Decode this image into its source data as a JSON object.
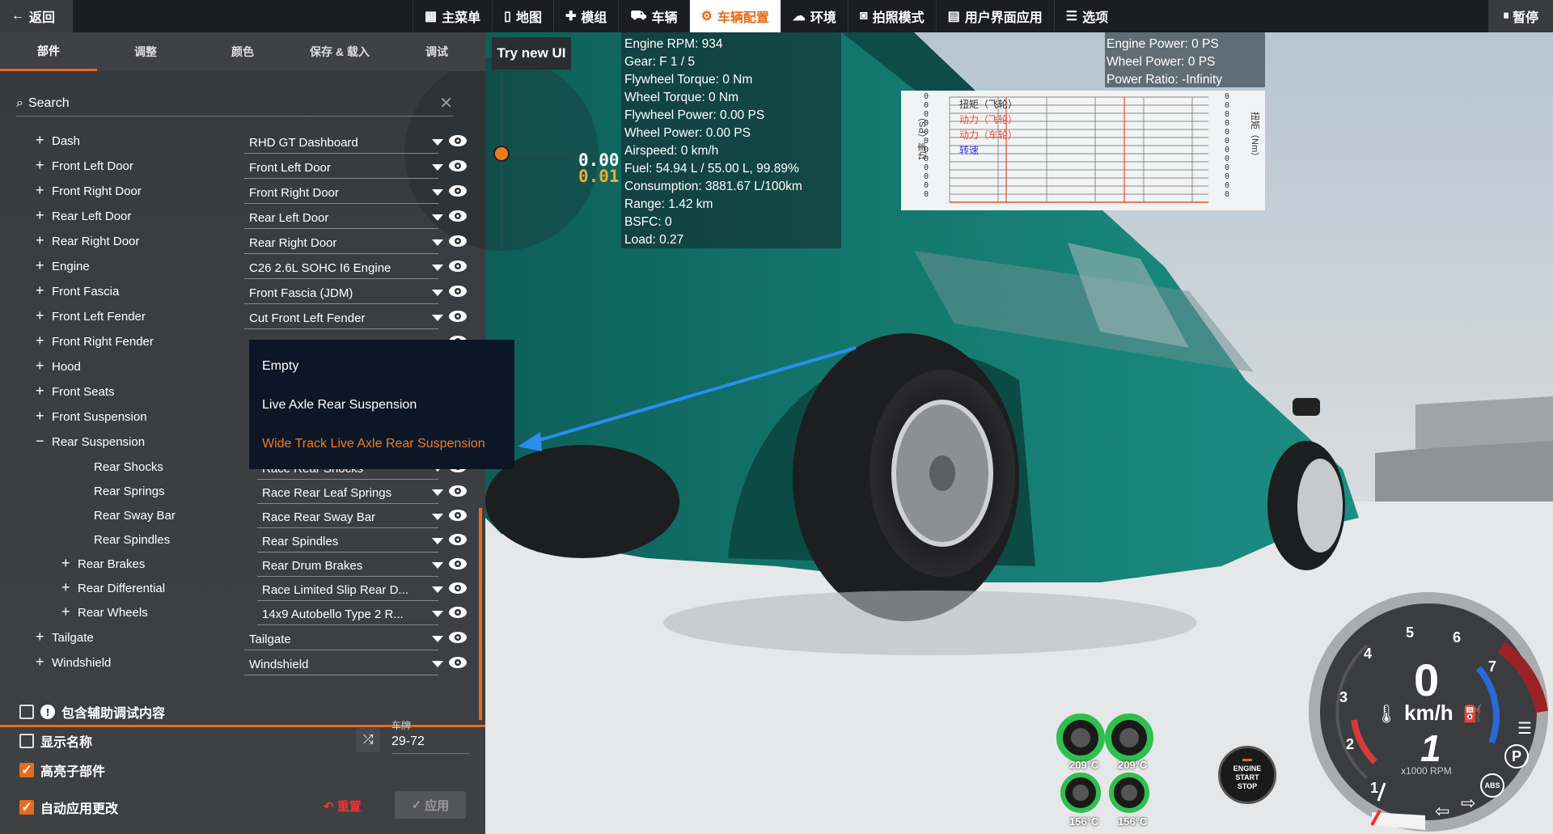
{
  "topbar": {
    "back_label": "返回",
    "menu": [
      "主菜单",
      "地图",
      "模组",
      "车辆",
      "车辆配置",
      "环境",
      "拍照模式",
      "用户界面应用",
      "选项"
    ],
    "active_index": 4,
    "pause_label": "暂停"
  },
  "panel": {
    "tabs": [
      "部件",
      "调整",
      "颜色",
      "保存 & 载入",
      "调试"
    ],
    "active_tab": 0,
    "search_label": "Search",
    "search_clear": "✕",
    "rows": [
      {
        "label": "Dash",
        "value": "RHD GT Dashboard",
        "prefix": "+"
      },
      {
        "label": "Front Left Door",
        "value": "Front Left Door",
        "prefix": "+"
      },
      {
        "label": "Front Right Door",
        "value": "Front Right Door",
        "prefix": "+"
      },
      {
        "label": "Rear Left Door",
        "value": "Rear Left Door",
        "prefix": "+"
      },
      {
        "label": "Rear Right Door",
        "value": "Rear Right Door",
        "prefix": "+"
      },
      {
        "label": "Engine",
        "value": "C26 2.6L SOHC I6 Engine",
        "prefix": "+"
      },
      {
        "label": "Front Fascia",
        "value": "Front Fascia (JDM)",
        "prefix": "+"
      },
      {
        "label": "Front Left Fender",
        "value": "Cut Front Left Fender",
        "prefix": "+"
      },
      {
        "label": "Front Right Fender",
        "value": "",
        "prefix": "+"
      },
      {
        "label": "Hood",
        "value": "",
        "prefix": "+"
      },
      {
        "label": "Front Seats",
        "value": "",
        "prefix": "+"
      },
      {
        "label": "Front Suspension",
        "value": "",
        "prefix": "+"
      },
      {
        "label": "Rear Suspension",
        "value": "",
        "prefix": "−"
      },
      {
        "label": "Rear Shocks",
        "value": "Race Rear Shocks",
        "prefix": ""
      },
      {
        "label": "Rear Springs",
        "value": "Race Rear Leaf Springs",
        "prefix": ""
      },
      {
        "label": "Rear Sway Bar",
        "value": "Race Rear Sway Bar",
        "prefix": ""
      },
      {
        "label": "Rear Spindles",
        "value": "Rear Spindles",
        "prefix": ""
      },
      {
        "label": "Rear Brakes",
        "value": "Rear Drum Brakes",
        "prefix": "+"
      },
      {
        "label": "Rear Differential",
        "value": "Race Limited Slip Rear D...",
        "prefix": "+"
      },
      {
        "label": "Rear Wheels",
        "value": "14x9 Autobello Type 2 R...",
        "prefix": "+"
      },
      {
        "label": "Tailgate",
        "value": "Tailgate",
        "prefix": "+"
      },
      {
        "label": "Windshield",
        "value": "Windshield",
        "prefix": "+"
      }
    ],
    "dropdown": [
      "Empty",
      "Live Axle Rear Suspension",
      "Wide Track Live Axle Rear Suspension"
    ],
    "dropdown_selected": 2,
    "options": [
      {
        "label": "包含辅助调试内容",
        "checked": false
      },
      {
        "label": "显示名称",
        "checked": false
      },
      {
        "label": "高亮子部件",
        "checked": true
      },
      {
        "label": "自动应用更改",
        "checked": true
      }
    ],
    "plate_label": "车牌",
    "plate_value": "29-72",
    "reset_label": "重置",
    "apply_label": "应用"
  },
  "try_new_ui": "Try new UI",
  "overlay_numbers": {
    "a": "0.00",
    "b": "0.01"
  },
  "engine_info": [
    "Engine RPM: 934",
    "Gear: F 1 / 5",
    "Flywheel Torque: 0 Nm",
    "Wheel Torque: 0 Nm",
    "Flywheel Power: 0.00 PS",
    "Wheel Power: 0.00 PS",
    "Airspeed: 0 km/h",
    "Fuel: 54.94 L / 55.00 L, 99.89%",
    "Consumption: 3881.67 L/100km",
    "Range: 1.42 km",
    "BSFC: 0",
    "Load: 0.27"
  ],
  "power_info": [
    "Engine Power: 0 PS",
    "Wheel Power: 0 PS",
    "Power Ratio: -Infinity"
  ],
  "chart": {
    "legend": [
      {
        "label": "扭矩（飞轮）",
        "color": "#333333"
      },
      {
        "label": "动力（飞轮）",
        "color": "#e84b3a"
      },
      {
        "label": "动力（车轮）",
        "color": "#e84b3a"
      },
      {
        "label": "转速",
        "color": "#3b3bd6"
      }
    ],
    "left_axis_label": "功率（PS）",
    "right_axis_label": "扭矩（Nm）",
    "left_ticks": [
      "0",
      "0",
      "0",
      "0",
      "0",
      "0",
      "0",
      "0",
      "0",
      "0",
      "0",
      "0"
    ],
    "right_ticks": [
      "0",
      "0",
      "0",
      "0",
      "0",
      "0",
      "0",
      "0",
      "0",
      "0",
      "0",
      "0"
    ]
  },
  "temps": [
    "209°C",
    "209°C",
    "156°C",
    "156°C"
  ],
  "start_stop": [
    "ENGINE",
    "START",
    "STOP"
  ],
  "gauge": {
    "speed": "0",
    "unit": "km/h",
    "gear": "1",
    "rpm_label": "x1000 RPM",
    "ticks": [
      "1",
      "2",
      "3",
      "4",
      "5",
      "6",
      "7"
    ],
    "parking": "P",
    "abs": "ABS"
  }
}
